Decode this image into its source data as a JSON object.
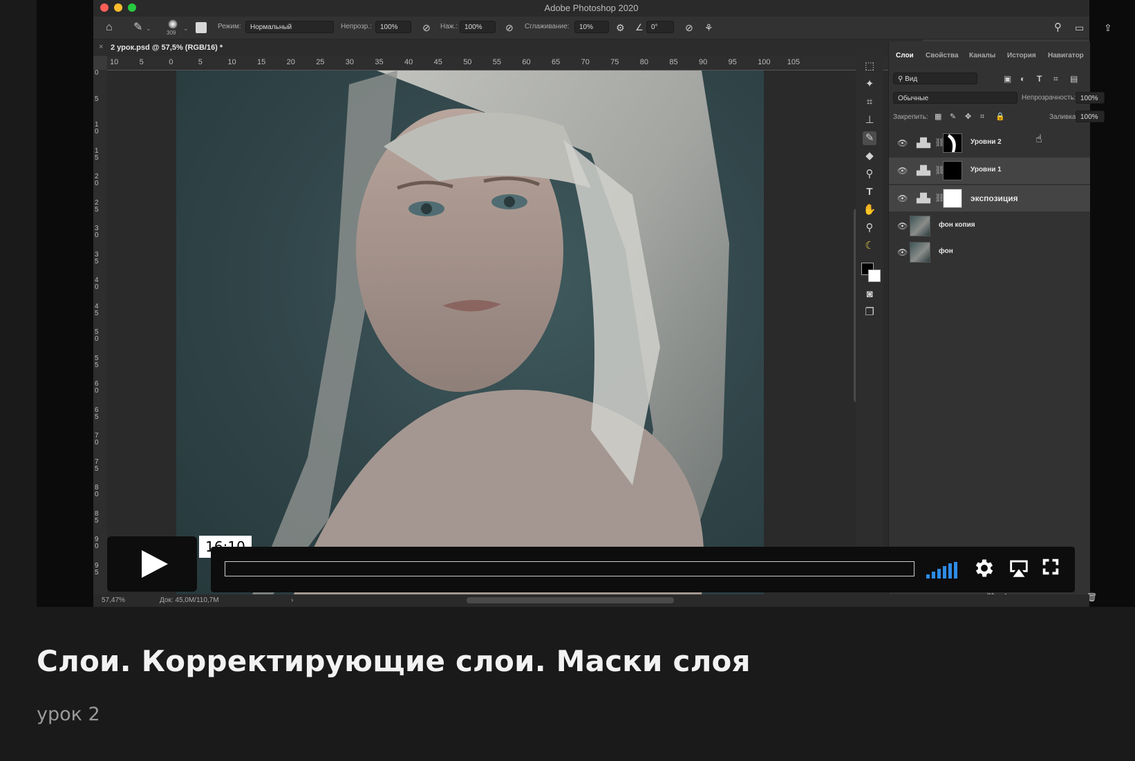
{
  "photoshop": {
    "window_title": "Adobe Photoshop 2020",
    "options": {
      "brush_size": "309",
      "mode_label": "Режим:",
      "mode_value": "Нормальный",
      "opacity_label": "Непрозр.:",
      "opacity_value": "100%",
      "flow_label": "Наж.:",
      "flow_value": "100%",
      "smoothing_label": "Сглаживание:",
      "smoothing_value": "10%",
      "angle_value": "0°"
    },
    "document_tab": "2 урок.psd @ 57,5% (RGB/16) *",
    "ruler_h": [
      "10",
      "5",
      "0",
      "5",
      "10",
      "15",
      "20",
      "25",
      "30",
      "35",
      "40",
      "45",
      "50",
      "55",
      "60",
      "65",
      "70",
      "75",
      "80",
      "85",
      "90",
      "95",
      "100",
      "105"
    ],
    "ruler_v": [
      "0",
      "5",
      "10",
      "15",
      "20",
      "25",
      "30",
      "35",
      "40",
      "45",
      "50",
      "55",
      "60",
      "65",
      "70",
      "75",
      "80",
      "85",
      "90",
      "95"
    ],
    "panel": {
      "tabs": [
        "Слои",
        "Свойства",
        "Каналы",
        "История",
        "Навигатор"
      ],
      "filter_value": "Вид",
      "blend_mode": "Обычные",
      "opacity_label": "Непрозрачность:",
      "opacity_value": "100%",
      "lock_label": "Закрепить:",
      "fill_label": "Заливка:",
      "fill_value": "100%",
      "layers": [
        {
          "name": "Уровни 2",
          "type": "adjustment",
          "mask": "partial"
        },
        {
          "name": "Уровни 1",
          "type": "adjustment",
          "mask": "black"
        },
        {
          "name": "экспозиция",
          "type": "adjustment",
          "mask": "white"
        },
        {
          "name": "фон копия",
          "type": "pixel"
        },
        {
          "name": "фон",
          "type": "pixel"
        }
      ]
    },
    "status": {
      "zoom": "57,47%",
      "doc_size": "Док: 45,0M/110,7M",
      "arrow": "›"
    }
  },
  "player": {
    "time": "16:10",
    "accent_color": "#2e8ce6"
  },
  "caption": {
    "title": "Слои. Корректирующие слои. Маски слоя",
    "subtitle": "урок 2"
  }
}
